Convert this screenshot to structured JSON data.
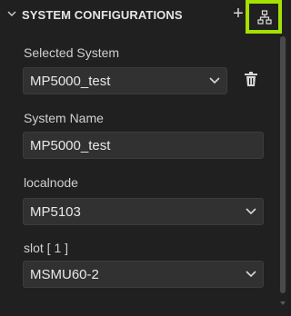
{
  "header": {
    "title": "SYSTEM CONFIGURATIONS",
    "add_label": "+"
  },
  "fields": {
    "selected_system": {
      "label": "Selected System",
      "value": "MP5000_test"
    },
    "system_name": {
      "label": "System Name",
      "value": "MP5000_test"
    },
    "localnode": {
      "label": "localnode",
      "value": "MP5103"
    },
    "slot": {
      "label": "slot [ 1 ]",
      "value": "MSMU60-2"
    }
  },
  "icons": {
    "collapse": "chevron-down-icon",
    "add": "plus-icon",
    "topology": "topology-icon",
    "delete": "trash-icon",
    "dropdown": "chevron-down-icon"
  },
  "colors": {
    "background": "#202020",
    "input_background": "#313131",
    "highlight": "#a4e100",
    "text": "#cccccc"
  }
}
